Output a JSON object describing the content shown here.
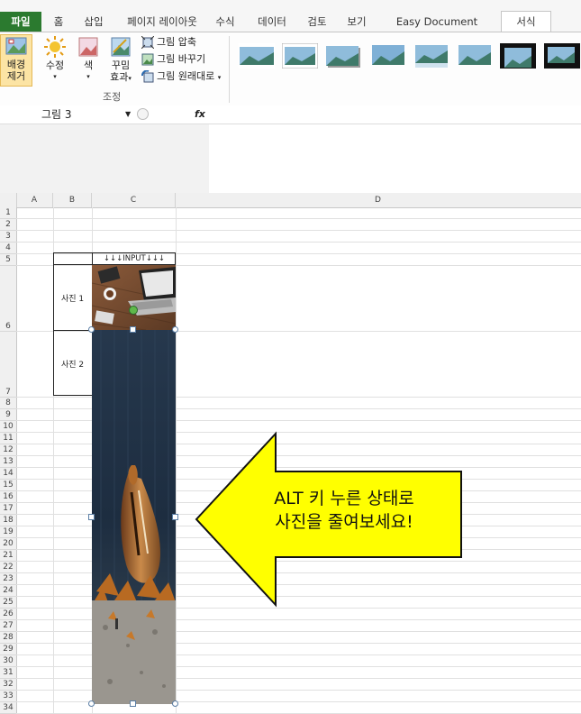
{
  "tabs": {
    "file": "파일",
    "home": "홈",
    "insert": "삽입",
    "page_layout": "페이지 레이아웃",
    "formulas": "수식",
    "data": "데이터",
    "review": "검토",
    "view": "보기",
    "easy_doc": "Easy Document Creator",
    "format": "서식"
  },
  "ribbon": {
    "remove_bg": "배경\n제거",
    "corrections": "수정",
    "color": "색",
    "artistic": "꾸밈\n효과",
    "compress": "그림 압축",
    "change": "그림 바꾸기",
    "reset": "그림 원래대로",
    "adjust_group": "조정",
    "dropdown_arrow": "▾"
  },
  "formula_bar": {
    "name_box": "그림 3",
    "fx": "fx",
    "value": ""
  },
  "columns": [
    "A",
    "B",
    "C",
    "D"
  ],
  "rows": [
    "1",
    "2",
    "3",
    "4",
    "5",
    "6",
    "7",
    "8",
    "9",
    "10",
    "11",
    "12",
    "13",
    "14",
    "15",
    "16",
    "17",
    "18",
    "19",
    "20",
    "21",
    "22",
    "23",
    "24",
    "25",
    "26",
    "27",
    "28",
    "29",
    "30",
    "31",
    "32",
    "33",
    "34"
  ],
  "cells": {
    "c5": "↓↓↓INPUT↓↓↓",
    "b6": "사진 1",
    "b7": "사진 2"
  },
  "callout": {
    "line1": "ALT 키 누른 상태로",
    "line2": "사진을 줄여보세요!",
    "fill": "#ffff00"
  }
}
